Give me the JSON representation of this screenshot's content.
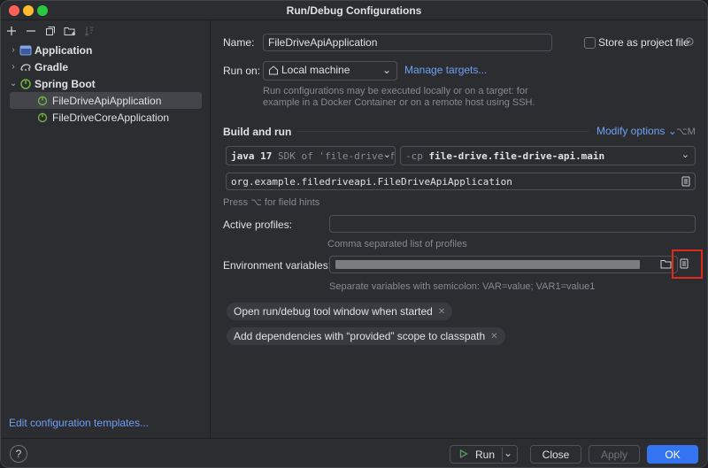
{
  "window": {
    "title": "Run/Debug Configurations"
  },
  "toolbar": {
    "add_icon": "plus-icon",
    "remove_icon": "minus-icon",
    "copy_icon": "copy-icon",
    "folder_icon": "new-folder-icon",
    "sort_icon": "sort-icon"
  },
  "tree": {
    "application": "Application",
    "gradle": "Gradle",
    "spring_boot": "Spring Boot",
    "config_api": "FileDriveApiApplication",
    "config_core": "FileDriveCoreApplication"
  },
  "sidebar": {
    "edit_templates": "Edit configuration templates..."
  },
  "form": {
    "name_label": "Name:",
    "name_value": "FileDriveApiApplication",
    "store_label": "Store as project file",
    "run_on_label": "Run on:",
    "run_on_value": "Local machine",
    "manage_targets": "Manage targets...",
    "run_on_hint_1": "Run configurations may be executed locally or on a target: for",
    "run_on_hint_2": "example in a Docker Container or on a remote host using SSH.",
    "build_run_title": "Build and run",
    "modify_options": "Modify options",
    "modify_shortcut": "⌥M",
    "java_version": "java 17",
    "java_sdk": "SDK of 'file-drive.f",
    "cp_prefix": "-cp",
    "cp_value": "file-drive.file-drive-api.main",
    "main_class": "org.example.filedriveapi.FileDriveApiApplication",
    "field_hint": "Press ⌥ for field hints",
    "profiles_label": "Active profiles:",
    "profiles_value": "",
    "profiles_hint": "Comma separated list of profiles",
    "env_label": "Environment variables:",
    "env_hint": "Separate variables with semicolon: VAR=value; VAR1=value1",
    "chip_1": "Open run/debug tool window when started",
    "chip_2": "Add dependencies with “provided” scope to classpath"
  },
  "footer": {
    "help": "?",
    "run": "Run",
    "close": "Close",
    "apply": "Apply",
    "ok": "OK"
  },
  "colors": {
    "accent": "#3574f0",
    "link": "#6fa0f6",
    "highlight": "#e02a1c",
    "spring_green": "#6db33f"
  }
}
